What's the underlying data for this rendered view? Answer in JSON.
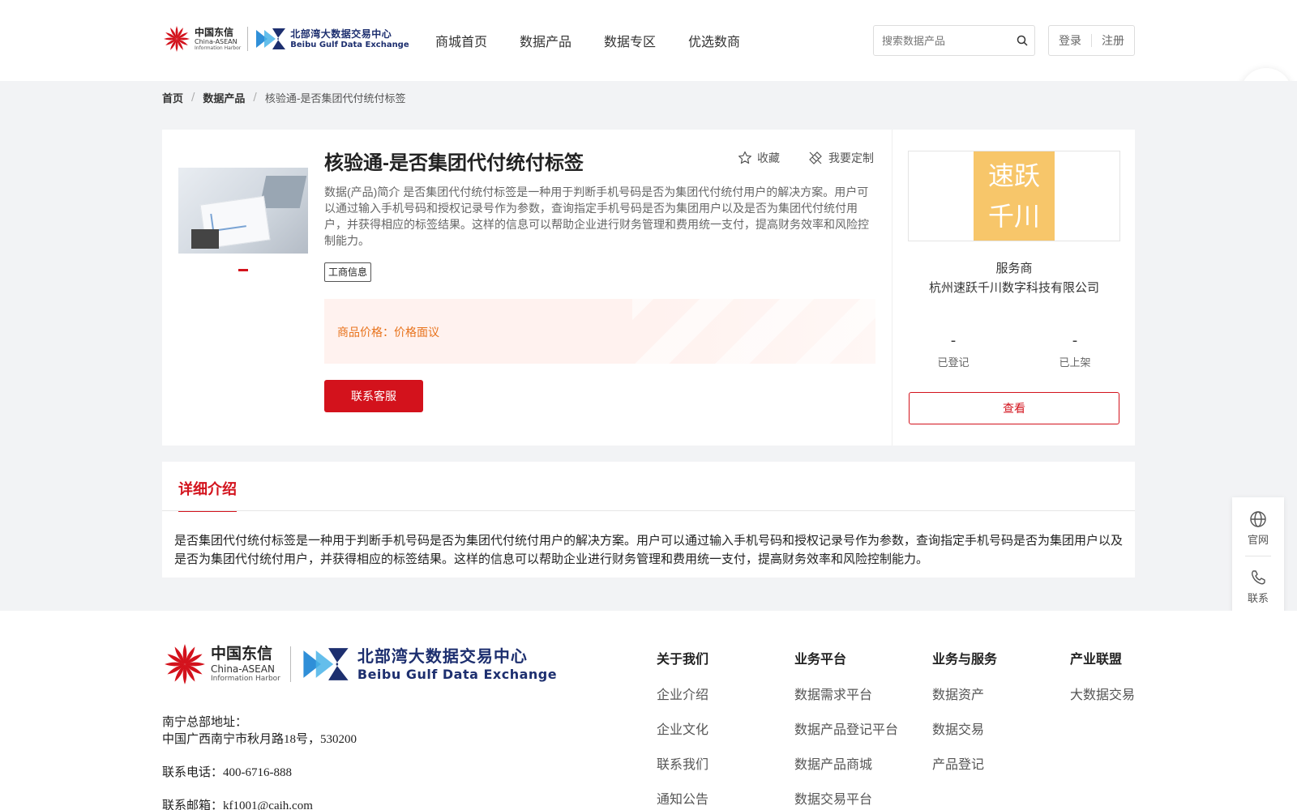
{
  "header": {
    "logo_cn_line1": "中国东信",
    "logo_cn_line2": "China-ASEAN",
    "logo_cn_line3": "Information Harbor",
    "logo_bb_line1": "北部湾大数据交易中心",
    "logo_bb_line2": "Beibu Gulf Data Exchange",
    "nav": [
      "商城首页",
      "数据产品",
      "数据专区",
      "优选数商"
    ],
    "search_placeholder": "搜索数据产品",
    "login": "登录",
    "register": "注册"
  },
  "breadcrumb": {
    "home": "首页",
    "category": "数据产品",
    "current": "核验通-是否集团代付统付标签",
    "sep": "/"
  },
  "product": {
    "title": "核验通-是否集团代付统付标签",
    "favorite": "收藏",
    "customize": "我要定制",
    "description": "数据(产品)简介 是否集团代付统付标签是一种用于判断手机号码是否为集团代付统付用户的解决方案。用户可以通过输入手机号码和授权记录号作为参数，查询指定手机号码是否为集团用户以及是否为集团代付统付用户，并获得相应的标签结果。这样的信息可以帮助企业进行财务管理和费用统一支付，提高财务效率和风险控制能力。",
    "tag": "工商信息",
    "price_label": "商品价格：",
    "price_value": "价格面议",
    "contact_button": "联系客服"
  },
  "vendor": {
    "logo_line1": "速跃",
    "logo_line2": "千川",
    "role": "服务商",
    "name": "杭州速跃千川数字科技有限公司",
    "stat1_value": "-",
    "stat1_label": "已登记",
    "stat2_value": "-",
    "stat2_label": "已上架",
    "view_button": "查看"
  },
  "detail": {
    "tab": "详细介绍",
    "text": "是否集团代付统付标签是一种用于判断手机号码是否为集团代付统付用户的解决方案。用户可以通过输入手机号码和授权记录号作为参数，查询指定手机号码是否为集团用户以及是否为集团代付统付用户，并获得相应的标签结果。这样的信息可以帮助企业进行财务管理和费用统一支付，提高财务效率和风险控制能力。"
  },
  "float_bar": {
    "website": "官网",
    "contact": "联系"
  },
  "footer": {
    "logo_cn_line1": "中国东信",
    "logo_cn_line2": "China-ASEAN",
    "logo_cn_line3": "Information Harbor",
    "logo_bb_line1": "北部湾大数据交易中心",
    "logo_bb_line2": "Beibu Gulf Data Exchange",
    "address_label": "南宁总部地址：",
    "address": "中国广西南宁市秋月路18号，530200",
    "phone": "联系电话：400-6716-888",
    "email": "联系邮箱：kf1001@caih.com",
    "columns": [
      {
        "title": "关于我们",
        "links": [
          "企业介绍",
          "企业文化",
          "联系我们",
          "通知公告"
        ]
      },
      {
        "title": "业务平台",
        "links": [
          "数据需求平台",
          "数据产品登记平台",
          "数据产品商城",
          "数据交易平台"
        ]
      },
      {
        "title": "业务与服务",
        "links": [
          "数据资产",
          "数据交易",
          "产品登记"
        ]
      },
      {
        "title": "产业联盟",
        "links": [
          "大数据交易"
        ]
      }
    ]
  },
  "colors": {
    "brand_red": "#d3121c",
    "price_orange": "#e8731c",
    "brand_blue": "#1d2f6f"
  }
}
